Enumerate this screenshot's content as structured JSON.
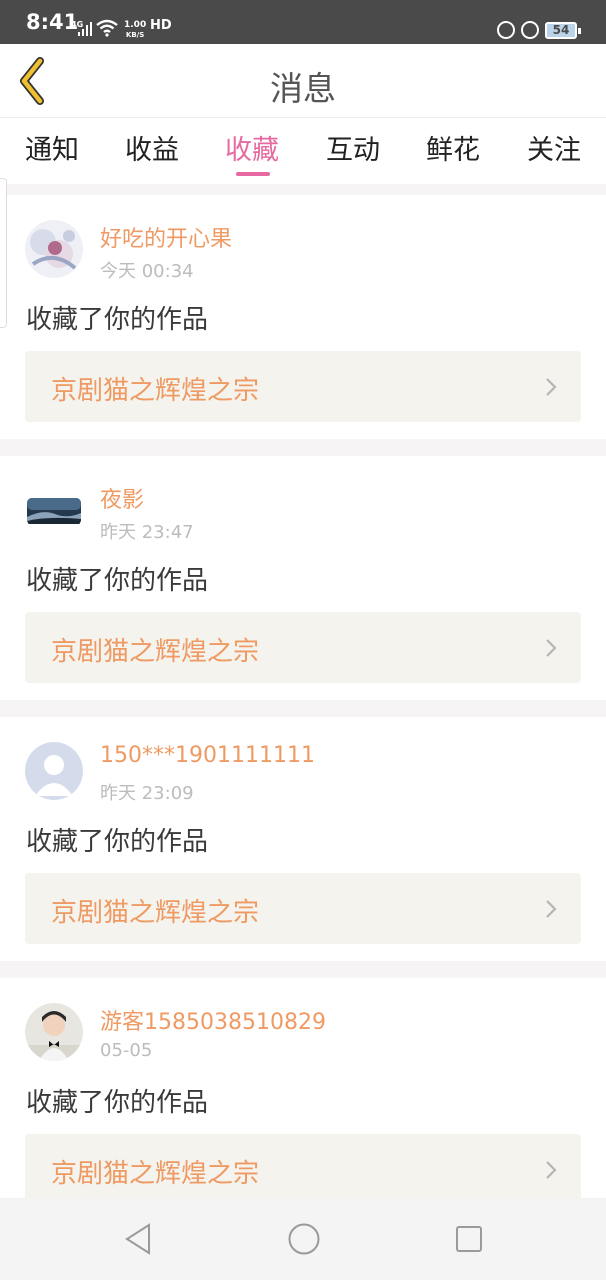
{
  "status_bar": {
    "time": "8:41",
    "network": "4G",
    "speed_value": "1.00",
    "speed_unit": "KB/S",
    "hd": "HD",
    "battery": "54"
  },
  "header": {
    "title": "消息",
    "back_icon": "chevron-left-icon",
    "back_color": "#f0c030"
  },
  "tabs": [
    {
      "label": "通知",
      "active": false
    },
    {
      "label": "收益",
      "active": false
    },
    {
      "label": "收藏",
      "active": true
    },
    {
      "label": "互动",
      "active": false
    },
    {
      "label": "鲜花",
      "active": false
    },
    {
      "label": "关注",
      "active": false
    }
  ],
  "accent_color": "#e66aa1",
  "name_color": "#ef9a63",
  "messages": [
    {
      "username": "好吃的开心果",
      "time": "今天 00:34",
      "text": "收藏了你的作品",
      "work": "京剧猫之辉煌之宗"
    },
    {
      "username": "夜影",
      "time": "昨天 23:47",
      "text": "收藏了你的作品",
      "work": "京剧猫之辉煌之宗"
    },
    {
      "username": "150***1901111111",
      "time": "昨天 23:09",
      "text": "收藏了你的作品",
      "work": "京剧猫之辉煌之宗"
    },
    {
      "username": "游客1585038510829",
      "time": "05-05",
      "text": "收藏了你的作品",
      "work": "京剧猫之辉煌之宗"
    }
  ],
  "nav_bar": {
    "back_icon": "triangle-back-icon",
    "home_icon": "circle-home-icon",
    "recents_icon": "square-recents-icon"
  }
}
